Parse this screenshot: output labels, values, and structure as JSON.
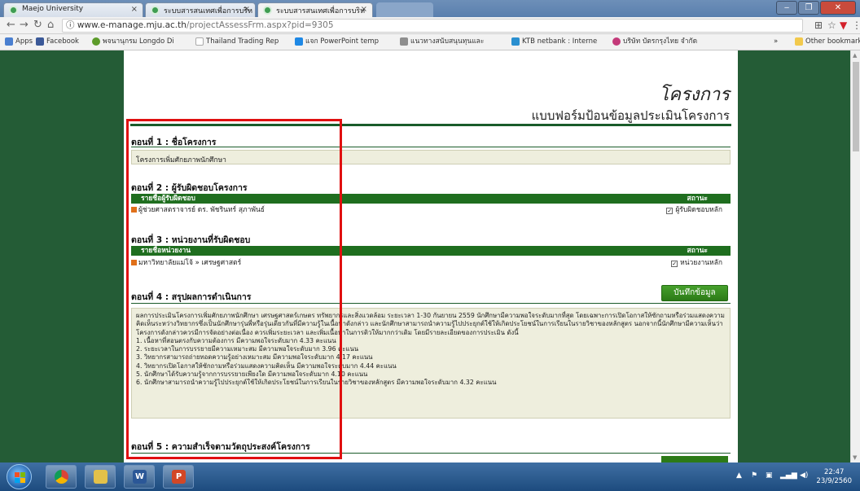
{
  "tabs": [
    {
      "title": "Maejo University",
      "active": false
    },
    {
      "title": "ระบบสารสนเทศเพื่อการบริห",
      "active": false
    },
    {
      "title": "ระบบสารสนเทศเพื่อการบริห",
      "active": true
    }
  ],
  "address": {
    "host": "www.e-manage.mju.ac.th",
    "path": "/projectAssessFrm.aspx?pid=9305"
  },
  "bookmarks": {
    "items": [
      {
        "label": "Apps",
        "color": "#4a7fd0"
      },
      {
        "label": "Facebook",
        "color": "#3b5998"
      },
      {
        "label": "พจนานุกรม Longdo Di",
        "color": "#5c9b2a"
      },
      {
        "label": "Thailand Trading Rep",
        "color": "#aaaaaa"
      },
      {
        "label": "แจก PowerPoint temp",
        "color": "#1e88e5"
      },
      {
        "label": "แนวทางสนับสนุนทุนและ",
        "color": "#8e8e8e"
      },
      {
        "label": "KTB netbank : Interne",
        "color": "#2a8fd0"
      },
      {
        "label": "บริษัท บัตรกรุงไทย จำกัด",
        "color": "#c43a7a"
      }
    ],
    "more": "»",
    "other": "Other bookmarks"
  },
  "page": {
    "title": "โครงการ",
    "subtitle": "แบบฟอร์มป้อนข้อมูลประเมินโครงการ",
    "section1": {
      "heading": "ตอนที่ 1 : ชื่อโครงการ",
      "value": "โครงการเพิ่มศักยภาพนักศึกษา"
    },
    "section2": {
      "heading": "ตอนที่ 2 : ผู้รับผิดชอบโครงการ",
      "col_name": "รายชื่อผู้รับผิดชอบ",
      "col_status": "สถานะ",
      "row_name": "ผู้ช่วยศาสตราจารย์ ดร. พัชรินทร์ สุภาพันธ์",
      "row_status": "ผู้รับผิดชอบหลัก"
    },
    "section3": {
      "heading": "ตอนที่ 3 : หน่วยงานที่รับผิดชอบ",
      "col_name": "รายชื่อหน่วยงาน",
      "col_status": "สถานะ",
      "row_name": "มหาวิทยาลัยแม่โจ้ » เศรษฐศาสตร์",
      "row_status": "หน่วยงานหลัก"
    },
    "section4": {
      "heading": "ตอนที่ 4 : สรุปผลการดำเนินการ",
      "save_button": "บันทึกข้อมูล",
      "summary_intro": "ผลการประเมินโครงการเพิ่มศักยภาพนักศึกษา เศรษฐศาสตร์เกษตร ทรัพยากรและสิ่งแวดล้อม ระยะเวลา 1-30 กันยายน 2559 นักศึกษามีความพอใจระดับมากที่สุด โดยเฉพาะการเปิดโอกาสให้ซักถามหรือร่วมแสดงความคิดเห็นระหว่างวิทยากรซึ่งเป็นนักศึกษารุ่นพี่หรือรุ่นเดียวกันที่มีความรู้ในเนื้อหาดังกล่าว และนักศึกษาสามารถนำความรู้ไปประยุกต์ใช้ให้เกิดประโยชน์ในการเรียนในรายวิชาของหลักสูตร นอกจากนี้นักศึกษามีความเห็นว่าโครงการดังกล่าวควรมีการจัดอย่างต่อเนื่อง ควรเพิ่มระยะเวลา และเพิ่มเนื้อหาในการติวให้มากกว่าเดิม โดยมีรายละเอียดของการประเมิน ดังนี้",
      "items": [
        "1. เนื้อหาที่สอนตรงกับความต้องการ มีความพอใจระดับมาก 4.33 คะแนน",
        "2. ระยะเวลาในการบรรยายมีความเหมาะสม มีความพอใจระดับมาก 3.96 คะแนน",
        "3. วิทยากรสามารถถ่ายทอดความรู้อย่างเหมาะสม มีความพอใจระดับมาก 4.17 คะแนน",
        "4. วิทยากรเปิดโอกาสให้ซักถามหรือร่วมแสดงความคิดเห็น มีความพอใจระดับมาก 4.44 คะแนน",
        "5. นักศึกษาได้รับความรู้จากการบรรยายเพียงใด มีความพอใจระดับมาก 4.10 คะแนน",
        "6. นักศึกษาสามารถนำความรู้ไปประยุกต์ใช้ให้เกิดประโยชน์ในการเรียนในรายวิชาของหลักสูตร มีความพอใจระดับมาก 4.32 คะแนน"
      ]
    },
    "section5": {
      "heading": "ตอนที่ 5 : ความสำเร็จตามวัตถุประสงค์โครงการ"
    }
  },
  "taskbar": {
    "apps": [
      {
        "name": "chrome",
        "glyph": "",
        "color": "#e8b012"
      },
      {
        "name": "explorer",
        "glyph": "",
        "color": "#e3c14a"
      },
      {
        "name": "word",
        "glyph": "W",
        "color": "#2b5797"
      },
      {
        "name": "powerpoint",
        "glyph": "P",
        "color": "#d24726"
      }
    ],
    "time": "22:47",
    "date": "23/9/2560"
  }
}
